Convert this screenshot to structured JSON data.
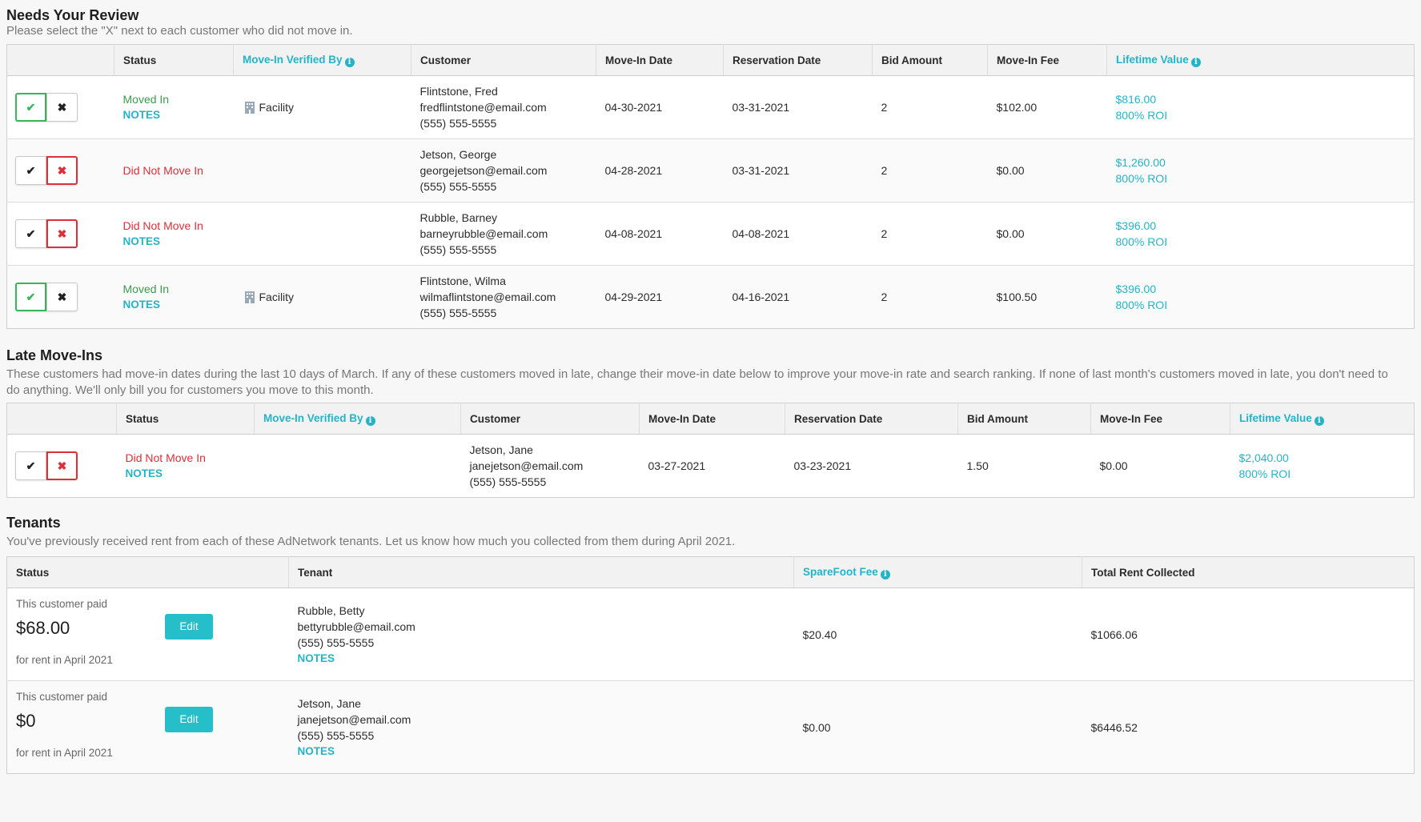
{
  "review": {
    "title": "Needs Your Review",
    "desc": "Please select the \"X\" next to each customer who did not move in.",
    "headers": {
      "status": "Status",
      "verified_by": "Move-In Verified By",
      "customer": "Customer",
      "move_in_date": "Move-In Date",
      "reservation_date": "Reservation Date",
      "bid_amount": "Bid Amount",
      "move_in_fee": "Move-In Fee",
      "lifetime_value": "Lifetime Value"
    },
    "rows": [
      {
        "status": "Moved In",
        "notes": "NOTES",
        "verified": "Facility",
        "name": "Flintstone, Fred",
        "email": "fredflintstone@email.com",
        "phone": "(555) 555-5555",
        "move_in": "04-30-2021",
        "reservation": "03-31-2021",
        "bid": "2",
        "fee": "$102.00",
        "ltv": "$816.00",
        "roi": "800% ROI"
      },
      {
        "status": "Did Not Move In",
        "notes": "",
        "verified": "",
        "name": "Jetson, George",
        "email": "georgejetson@email.com",
        "phone": "(555) 555-5555",
        "move_in": "04-28-2021",
        "reservation": "03-31-2021",
        "bid": "2",
        "fee": "$0.00",
        "ltv": "$1,260.00",
        "roi": "800% ROI"
      },
      {
        "status": "Did Not Move In",
        "notes": "NOTES",
        "verified": "",
        "name": "Rubble, Barney",
        "email": "barneyrubble@email.com",
        "phone": "(555) 555-5555",
        "move_in": "04-08-2021",
        "reservation": "04-08-2021",
        "bid": "2",
        "fee": "$0.00",
        "ltv": "$396.00",
        "roi": "800% ROI"
      },
      {
        "status": "Moved In",
        "notes": "NOTES",
        "verified": "Facility",
        "name": "Flintstone, Wilma",
        "email": "wilmaflintstone@email.com",
        "phone": "(555) 555-5555",
        "move_in": "04-29-2021",
        "reservation": "04-16-2021",
        "bid": "2",
        "fee": "$100.50",
        "ltv": "$396.00",
        "roi": "800% ROI"
      }
    ]
  },
  "late": {
    "title": "Late Move-Ins",
    "desc": "These customers had move-in dates during the last 10 days of March. If any of these customers moved in late, change their move-in date below to improve your move-in rate and search ranking. If none of last month's customers moved in late, you don't need to do anything. We'll only bill you for customers you move to this month.",
    "rows": [
      {
        "status": "Did Not Move In",
        "notes": "NOTES",
        "verified": "",
        "name": "Jetson, Jane",
        "email": "janejetson@email.com",
        "phone": "(555) 555-5555",
        "move_in": "03-27-2021",
        "reservation": "03-23-2021",
        "bid": "1.50",
        "fee": "$0.00",
        "ltv": "$2,040.00",
        "roi": "800% ROI"
      }
    ]
  },
  "tenants": {
    "title": "Tenants",
    "desc": "You've previously received rent from each of these AdNetwork tenants. Let us know how much you collected from them during April 2021.",
    "headers": {
      "status": "Status",
      "tenant": "Tenant",
      "fee": "SpareFoot Fee",
      "total": "Total Rent Collected"
    },
    "rows": [
      {
        "paid_label": "This customer paid",
        "amount": "$68.00",
        "for_label": "for rent in April 2021",
        "edit": "Edit",
        "name": "Rubble, Betty",
        "email": "bettyrubble@email.com",
        "phone": "(555) 555-5555",
        "notes": "NOTES",
        "fee": "$20.40",
        "total": "$1066.06"
      },
      {
        "paid_label": "This customer paid",
        "amount": "$0",
        "for_label": "for rent in April 2021",
        "edit": "Edit",
        "name": "Jetson, Jane",
        "email": "janejetson@email.com",
        "phone": "(555) 555-5555",
        "notes": "NOTES",
        "fee": "$0.00",
        "total": "$6446.52"
      }
    ]
  },
  "icons": {
    "check": "check-icon",
    "close": "close-icon",
    "info": "info-icon",
    "building": "building-icon"
  },
  "colors": {
    "accent": "#26b3c6",
    "green": "#3bb55a",
    "red": "#d9303a",
    "button": "#26bfc9"
  }
}
